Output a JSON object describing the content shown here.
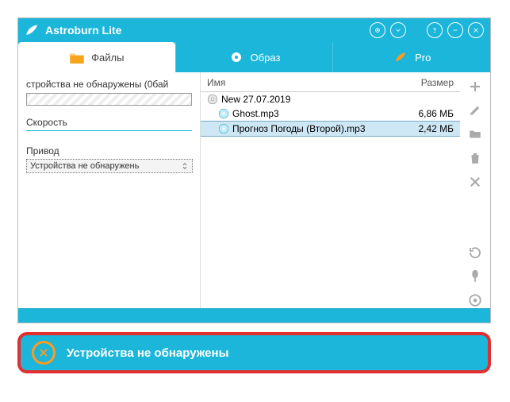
{
  "app": {
    "title": "Astroburn Lite"
  },
  "tabs": {
    "files": "Файлы",
    "image": "Образ",
    "pro": "Pro"
  },
  "sidebar": {
    "status": "стройства не обнаружены (0бай",
    "speed_label": "Скорость",
    "drive_label": "Привод",
    "drive_value": "Устройства не обнаружень"
  },
  "filelist": {
    "header_name": "Имя",
    "header_size": "Размер",
    "root": "New 27.07.2019",
    "items": [
      {
        "name": "Ghost.mp3",
        "size": "6,86 МБ"
      },
      {
        "name": "Прогноз Погоды (Второй).mp3",
        "size": "2,42 МБ"
      }
    ]
  },
  "error": {
    "message": "Устройства не обнаружены"
  }
}
